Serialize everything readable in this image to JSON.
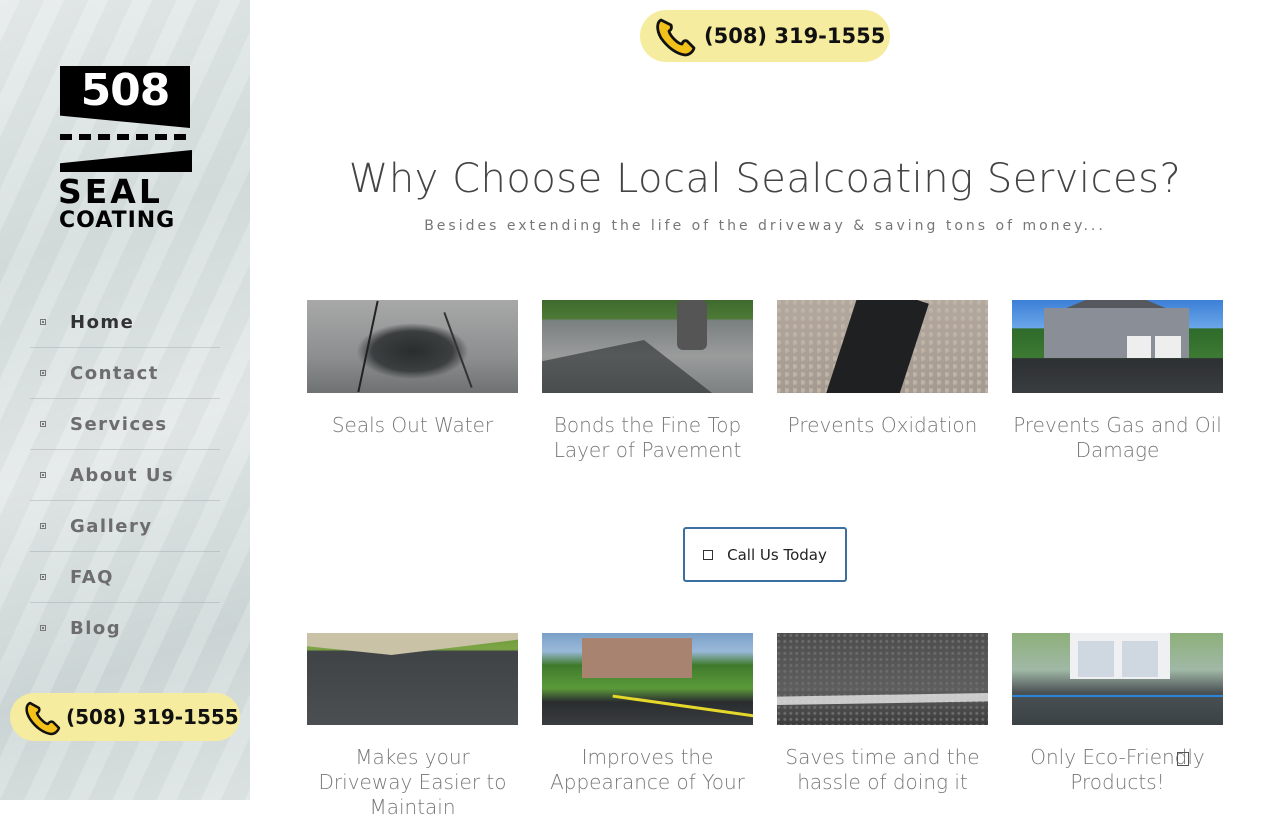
{
  "brand": {
    "logo_number": "508",
    "logo_word1": "SEAL",
    "logo_word2": "COATING"
  },
  "sidebar": {
    "items": [
      {
        "label": "Home",
        "active": true
      },
      {
        "label": "Contact"
      },
      {
        "label": "Services"
      },
      {
        "label": "About Us"
      },
      {
        "label": "Gallery"
      },
      {
        "label": "FAQ"
      },
      {
        "label": "Blog"
      }
    ],
    "phone": "(508) 319-1555"
  },
  "header": {
    "phone": "(508) 319-1555"
  },
  "main": {
    "title": "Why Choose Local Sealcoating Services?",
    "subtitle": "Besides extending the life of the driveway & saving tons of money...",
    "cta_label": "Call Us Today",
    "row1": [
      {
        "caption": "Seals Out Water"
      },
      {
        "caption": "Bonds the Fine Top Layer of Pavement"
      },
      {
        "caption": "Prevents Oxidation"
      },
      {
        "caption": "Prevents Gas and Oil Damage"
      }
    ],
    "row2": [
      {
        "caption": "Makes your Driveway Easier to Maintain"
      },
      {
        "caption": "Improves the Appearance of Your"
      },
      {
        "caption": "Saves time and the hassle of doing it"
      },
      {
        "caption": "Only Eco-Friendly Products!"
      }
    ]
  },
  "colors": {
    "phone_pill": "#f5ec9f",
    "cta_border": "#3a6fa0",
    "sidebar_bg": "#dde3e3"
  },
  "icons": {
    "phone": "phone-handset-icon",
    "cta": "phone-icon",
    "nav_bullet": "square-bullet-icon"
  }
}
